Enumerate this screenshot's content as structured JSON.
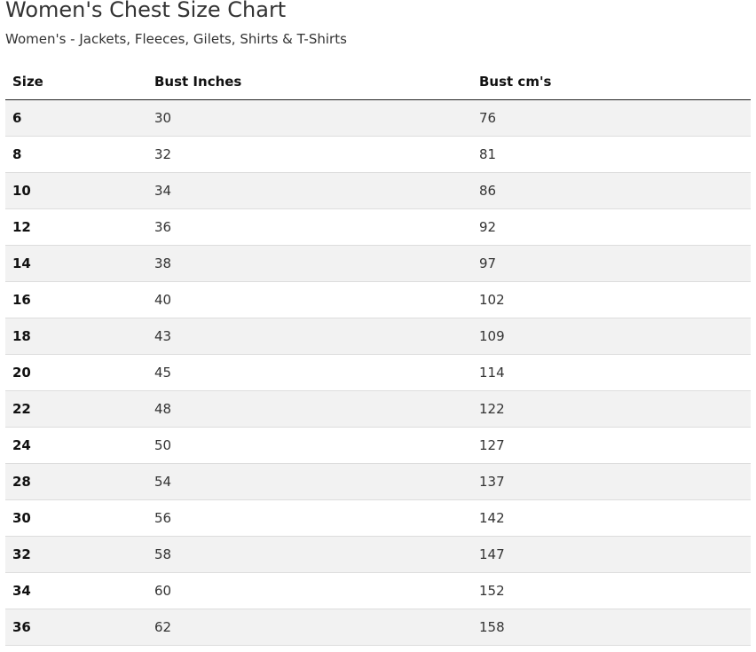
{
  "page": {
    "title": "Women's Chest Size Chart",
    "subtitle": "Women's - Jackets, Fleeces, Gilets, Shirts & T-Shirts"
  },
  "table": {
    "headers": [
      "Size",
      "Bust Inches",
      "Bust cm's"
    ],
    "rows": [
      [
        "6",
        "30",
        "76"
      ],
      [
        "8",
        "32",
        "81"
      ],
      [
        "10",
        "34",
        "86"
      ],
      [
        "12",
        "36",
        "92"
      ],
      [
        "14",
        "38",
        "97"
      ],
      [
        "16",
        "40",
        "102"
      ],
      [
        "18",
        "43",
        "109"
      ],
      [
        "20",
        "45",
        "114"
      ],
      [
        "22",
        "48",
        "122"
      ],
      [
        "24",
        "50",
        "127"
      ],
      [
        "28",
        "54",
        "137"
      ],
      [
        "30",
        "56",
        "142"
      ],
      [
        "32",
        "58",
        "147"
      ],
      [
        "34",
        "60",
        "152"
      ],
      [
        "36",
        "62",
        "158"
      ]
    ]
  },
  "colors": {
    "stripe": "#f2f2f2",
    "header_rule": "#222222",
    "row_rule": "#dddddd"
  }
}
